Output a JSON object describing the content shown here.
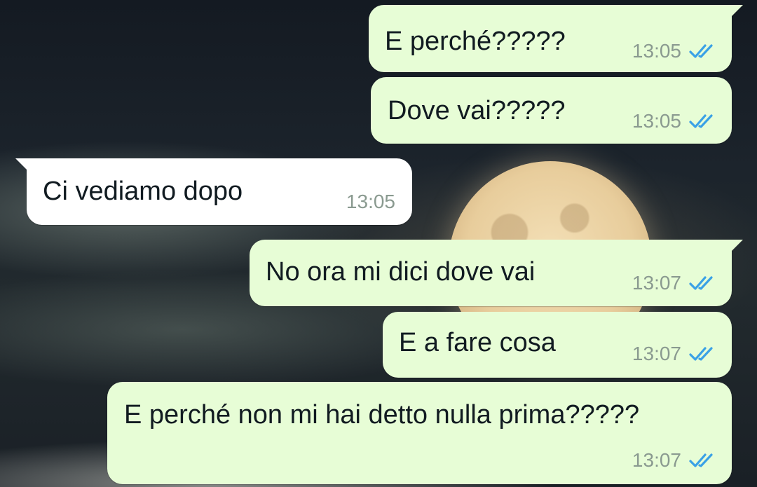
{
  "conversation": {
    "messages": [
      {
        "direction": "outgoing",
        "text": "E perché?????",
        "time": "13:05",
        "status": "read",
        "status_icon": "double-check-icon"
      },
      {
        "direction": "outgoing",
        "text": "Dove vai?????",
        "time": "13:05",
        "status": "read",
        "status_icon": "double-check-icon"
      },
      {
        "direction": "incoming",
        "text": "Ci vediamo dopo",
        "time": "13:05"
      },
      {
        "direction": "outgoing",
        "text": "No ora mi dici dove vai",
        "time": "13:07",
        "status": "read",
        "status_icon": "double-check-icon"
      },
      {
        "direction": "outgoing",
        "text": "E a fare cosa",
        "time": "13:07",
        "status": "read",
        "status_icon": "double-check-icon"
      },
      {
        "direction": "outgoing",
        "text": "E perché non mi hai detto nulla prima?????",
        "time": "13:07",
        "status": "read",
        "status_icon": "double-check-icon"
      }
    ]
  },
  "colors": {
    "outgoing_bubble": "#e7fdd6",
    "incoming_bubble": "#ffffff",
    "read_ticks": "#3aa1e6",
    "timestamp": "#8a9a90"
  },
  "wallpaper": {
    "icon": "full-moon-night-sky-wallpaper"
  }
}
